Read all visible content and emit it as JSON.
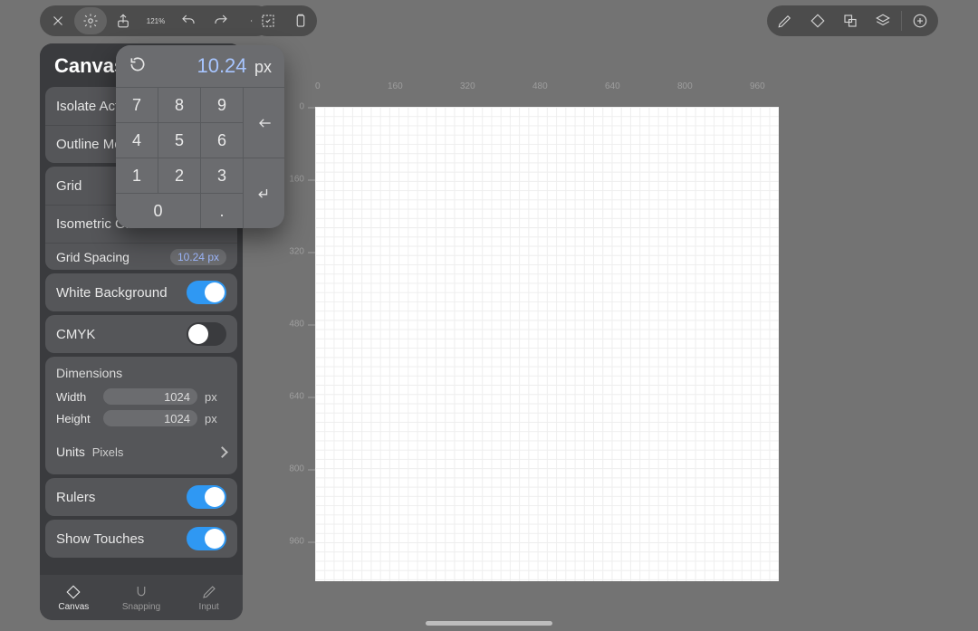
{
  "toolbar": {
    "zoom": "121%"
  },
  "side": {
    "title": "Canvas",
    "isolate": "Isolate Active Layer",
    "outline": "Outline Mode",
    "grid": "Grid",
    "iso_grid": "Isometric Grid",
    "grid_spacing_label": "Grid Spacing",
    "grid_spacing_value": "10.24 px",
    "white_bg": "White Background",
    "cmyk": "CMYK",
    "dimensions": "Dimensions",
    "width_label": "Width",
    "width_value": "1024",
    "height_label": "Height",
    "height_value": "1024",
    "px": "px",
    "units_label": "Units",
    "units_value": "Pixels",
    "rulers": "Rulers",
    "show_touches": "Show Touches"
  },
  "tabs": {
    "canvas": "Canvas",
    "snapping": "Snapping",
    "input": "Input"
  },
  "numpad": {
    "value": "10.24",
    "unit": "px",
    "keys": {
      "k7": "7",
      "k8": "8",
      "k9": "9",
      "k4": "4",
      "k5": "5",
      "k6": "6",
      "k1": "1",
      "k2": "2",
      "k3": "3",
      "k0": "0",
      "dot": "."
    }
  },
  "ruler_top": [
    "0",
    "160",
    "320",
    "480",
    "640",
    "800",
    "960"
  ],
  "ruler_left": [
    "0",
    "160",
    "320",
    "480",
    "640",
    "800",
    "960"
  ],
  "toggles": {
    "white_bg": true,
    "cmyk": false,
    "rulers": true,
    "show_touches": true
  }
}
